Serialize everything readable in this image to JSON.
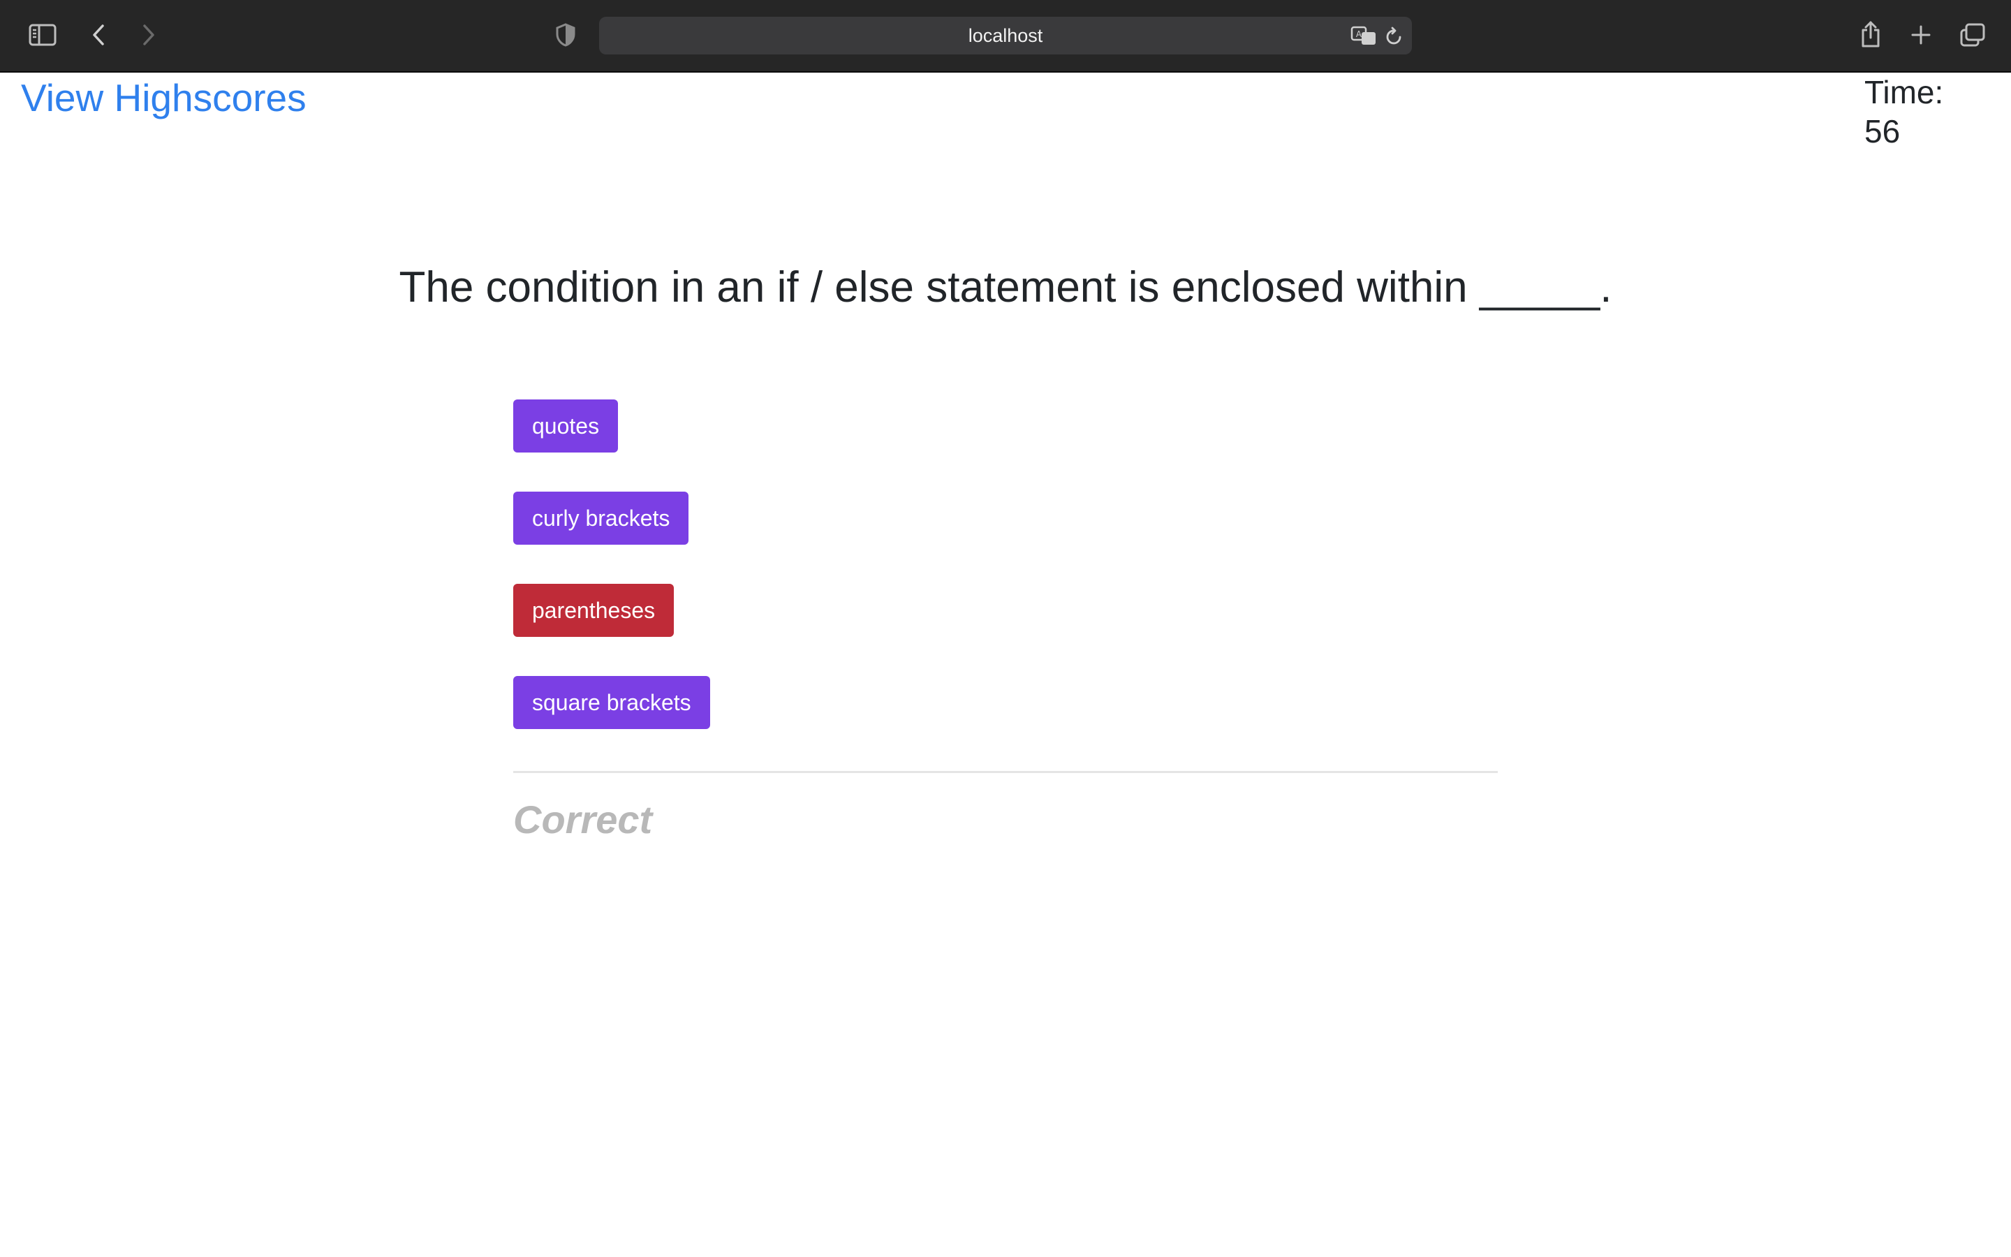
{
  "browser": {
    "address": "localhost",
    "icons": {
      "sidebar": "sidebar-icon",
      "back": "chevron-left-icon",
      "forward": "chevron-right-icon",
      "privacy": "shield-icon",
      "translate": "translate-icon",
      "reload": "reload-icon",
      "share": "share-icon",
      "new_tab": "plus-icon",
      "tabs": "tabs-overview-icon"
    }
  },
  "header": {
    "highscores_label": "View Highscores",
    "timer_label": "Time:",
    "timer_value": "56"
  },
  "quiz": {
    "question": "The condition in an if / else statement is enclosed within _____.",
    "answers": [
      {
        "label": "quotes",
        "state": "default"
      },
      {
        "label": "curly brackets",
        "state": "default"
      },
      {
        "label": "parentheses",
        "state": "selected"
      },
      {
        "label": "square brackets",
        "state": "default"
      }
    ],
    "feedback": "Correct"
  },
  "colors": {
    "link": "#2f80ed",
    "answer_default": "#7b3fe4",
    "answer_selected": "#bf2b38",
    "feedback": "#b8b8b8",
    "chrome_bg": "#262626"
  }
}
